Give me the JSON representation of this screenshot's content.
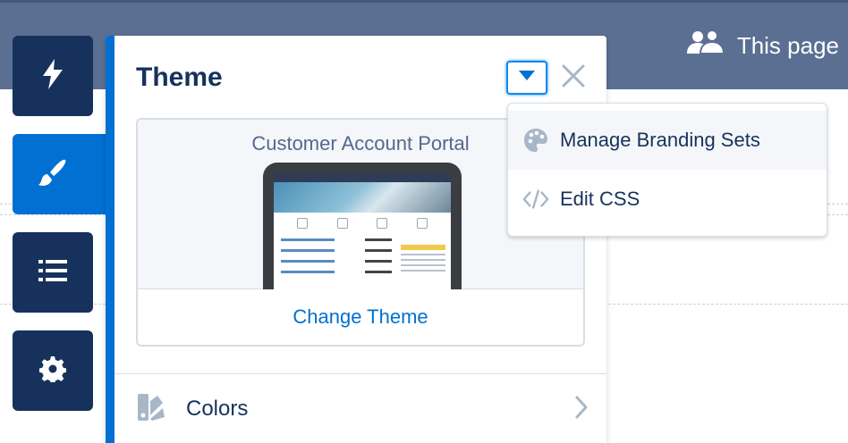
{
  "header": {
    "page_label": "This page",
    "icon": "users-icon"
  },
  "rail": {
    "items": [
      {
        "name": "lightning-icon",
        "active": false
      },
      {
        "name": "paintbrush-icon",
        "active": true
      },
      {
        "name": "list-icon",
        "active": false
      },
      {
        "name": "gear-icon",
        "active": false
      }
    ]
  },
  "panel": {
    "title": "Theme",
    "theme_card": {
      "theme_name": "Customer Account Portal",
      "change_label": "Change Theme"
    },
    "sections": [
      {
        "label": "Colors",
        "icon": "color-swatch-icon"
      }
    ]
  },
  "menu": {
    "items": [
      {
        "label": "Manage Branding Sets",
        "icon": "palette-icon",
        "highlighted": true
      },
      {
        "label": "Edit CSS",
        "icon": "code-icon",
        "highlighted": false
      }
    ]
  },
  "colors": {
    "accent": "#0070d2",
    "rail": "#16325c",
    "header": "#5b6f93",
    "text": "#16325c"
  }
}
